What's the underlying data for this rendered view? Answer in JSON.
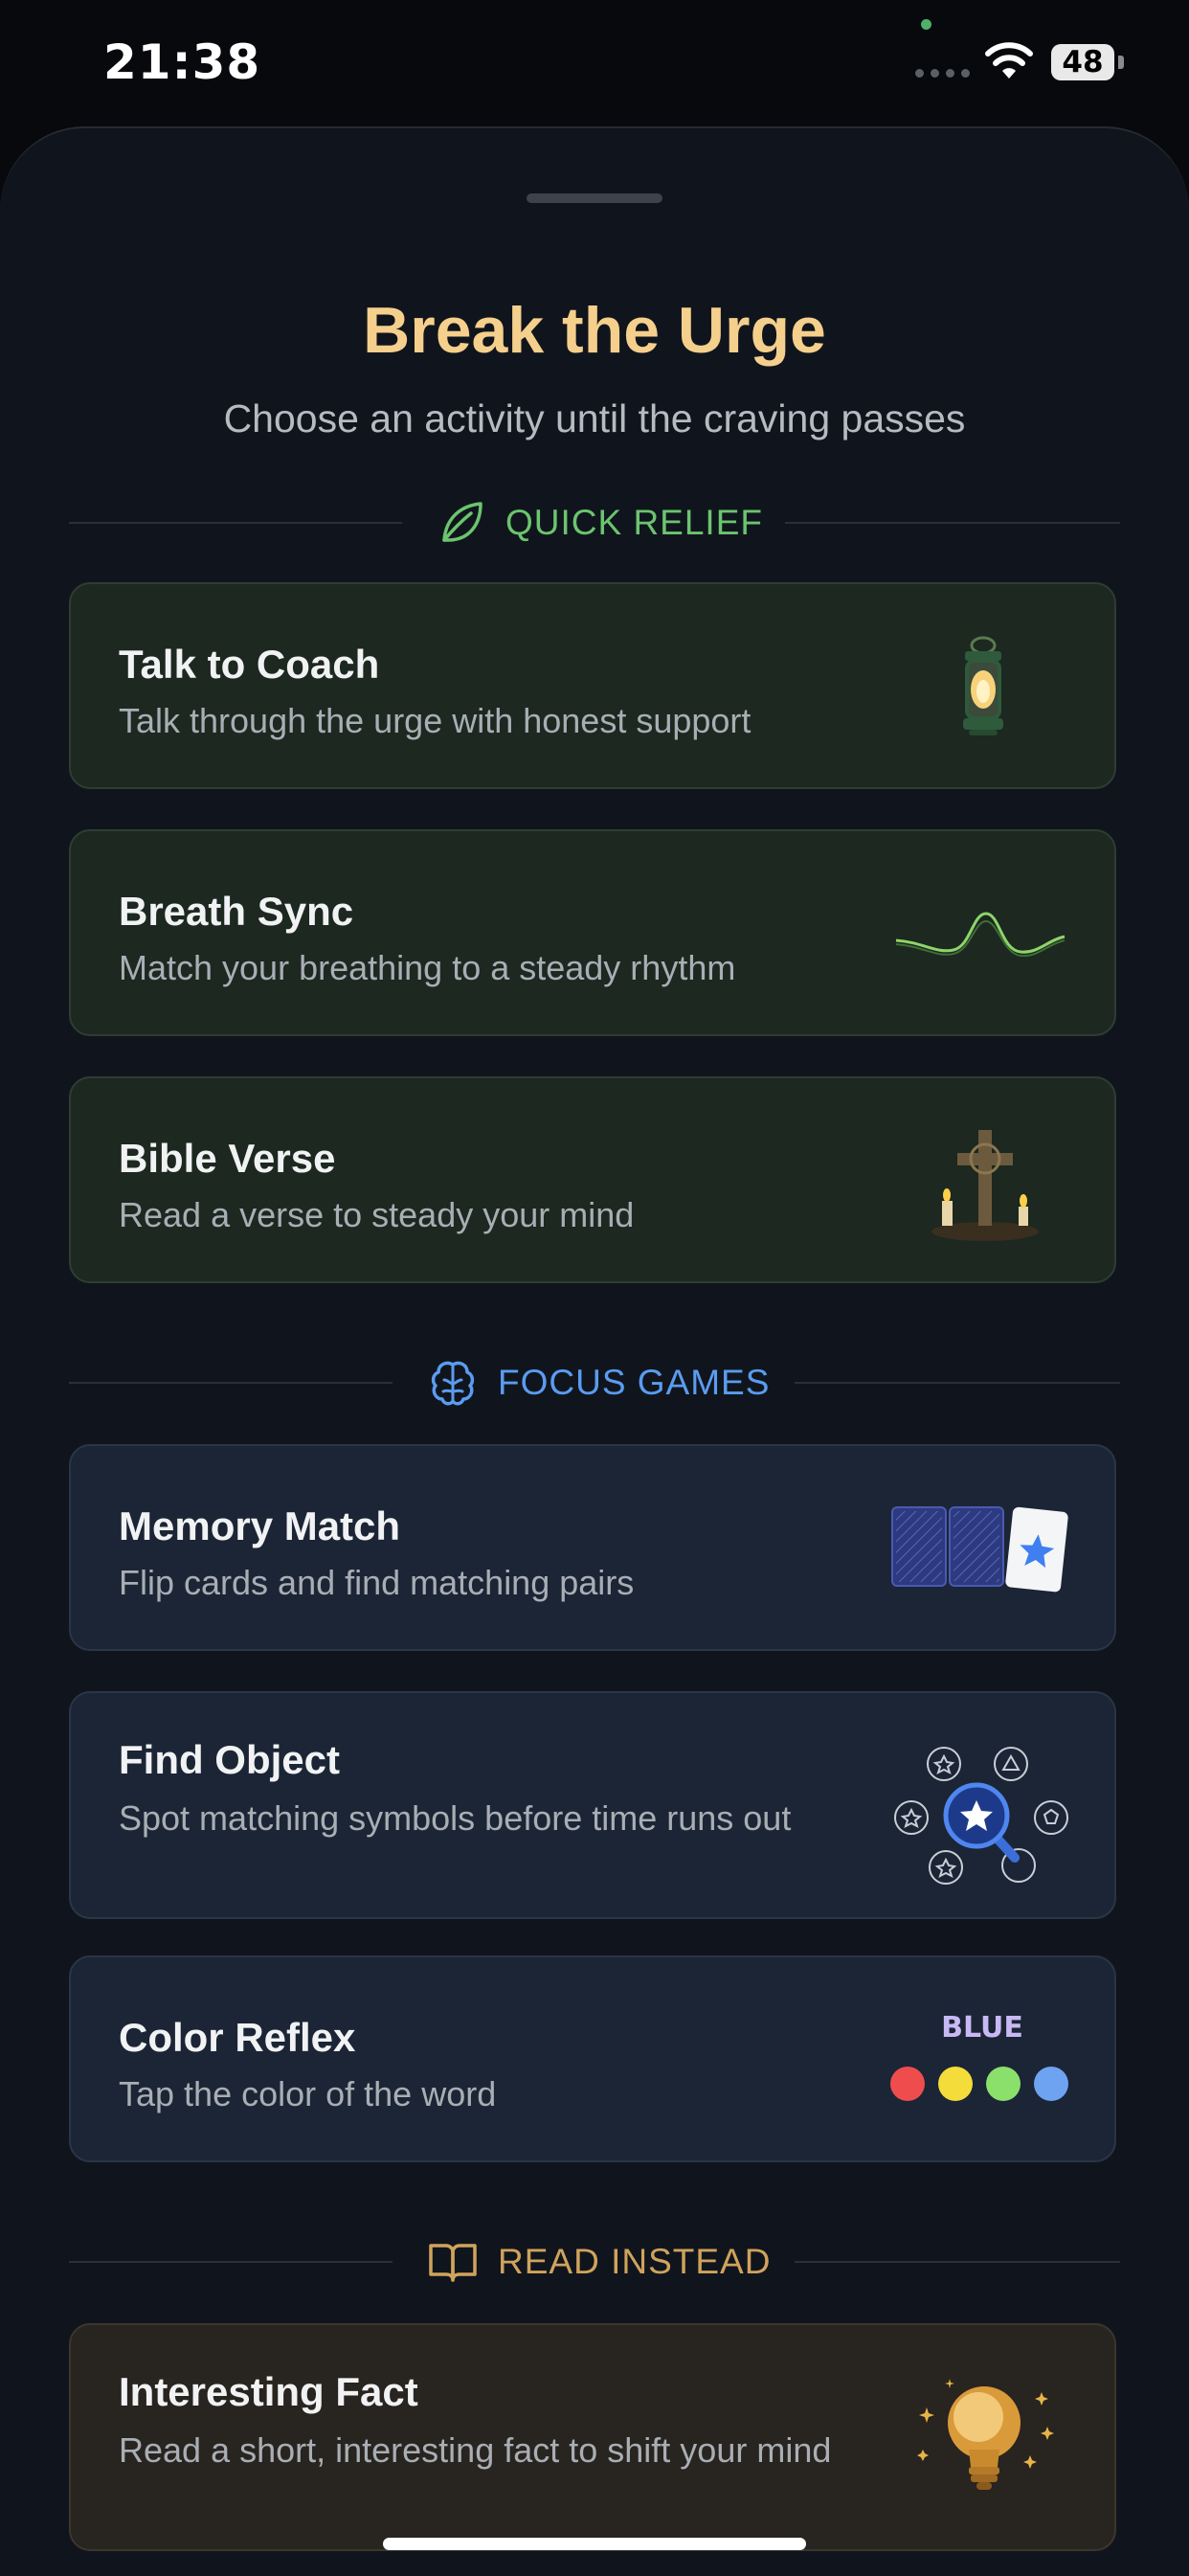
{
  "status_bar": {
    "time": "21:38",
    "battery": "48"
  },
  "sheet": {
    "title": "Break the Urge",
    "subtitle": "Choose an activity until the craving passes"
  },
  "sections": [
    {
      "label": "QUICK RELIEF",
      "icon": "leaf-icon",
      "color": "#6cc46f"
    },
    {
      "label": "FOCUS GAMES",
      "icon": "brain-icon",
      "color": "#5a9cf0"
    },
    {
      "label": "READ INSTEAD",
      "icon": "open-book-icon",
      "color": "#d0a35c"
    }
  ],
  "cards": [
    {
      "title": "Talk to Coach",
      "subtitle": "Talk through the urge with honest support",
      "icon": "lantern-icon"
    },
    {
      "title": "Breath Sync",
      "subtitle": "Match your breathing to a steady rhythm",
      "icon": "wave-icon"
    },
    {
      "title": "Bible Verse",
      "subtitle": "Read a verse to steady your mind",
      "icon": "cross-candles-icon"
    },
    {
      "title": "Memory Match",
      "subtitle": "Flip cards and find matching pairs",
      "icon": "cards-icon"
    },
    {
      "title": "Find Object",
      "subtitle": "Spot matching symbols before time runs out",
      "icon": "magnifier-symbols-icon"
    },
    {
      "title": "Color Reflex",
      "subtitle": "Tap the color of the word",
      "icon": "color-dots-icon",
      "word": "BLUE"
    },
    {
      "title": "Interesting Fact",
      "subtitle": "Read a short, interesting fact to shift your mind",
      "icon": "lightbulb-icon"
    }
  ],
  "colors": {
    "title": "#f5cf8c",
    "quick_relief_card": "#1c2820",
    "focus_game_card": "#1b2535",
    "read_card": "#28241f",
    "color_dots": [
      "#ef4d4d",
      "#f4dc3b",
      "#8be06b",
      "#6ea3f2"
    ]
  }
}
